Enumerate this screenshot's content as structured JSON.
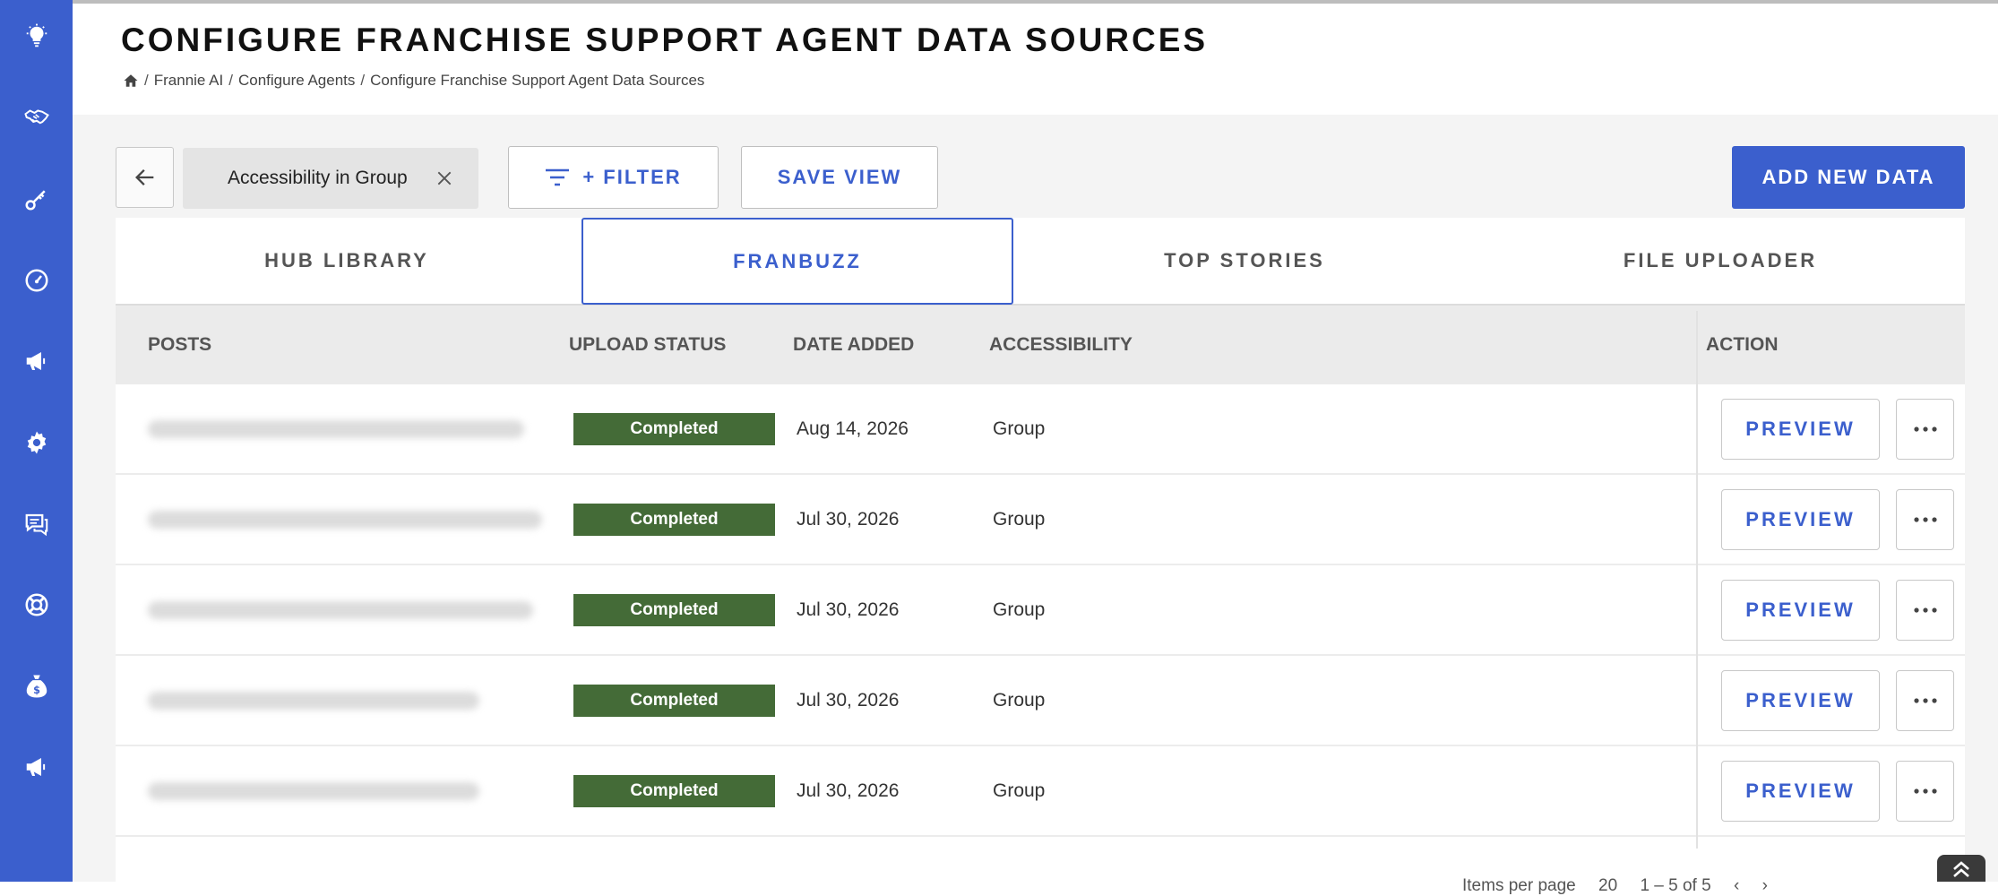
{
  "header": {
    "title": "CONFIGURE FRANCHISE SUPPORT AGENT DATA SOURCES",
    "breadcrumb": [
      "Frannie AI",
      "Configure Agents",
      "Configure Franchise Support Agent Data Sources"
    ]
  },
  "sidebar": {
    "icons": [
      "lightbulb-icon",
      "handshake-icon",
      "key-icon",
      "dashboard-gauge-icon",
      "megaphone-icon",
      "gear-icon",
      "chat-icon",
      "lifebuoy-icon",
      "money-bag-icon",
      "megaphone-icon"
    ]
  },
  "toolbar": {
    "filter_chip": "Accessibility in Group",
    "filter_label": "+ FILTER",
    "save_view_label": "SAVE VIEW",
    "add_new_label": "ADD NEW DATA"
  },
  "tabs": [
    {
      "label": "HUB LIBRARY",
      "active": false
    },
    {
      "label": "FRANBUZZ",
      "active": true
    },
    {
      "label": "TOP STORIES",
      "active": false
    },
    {
      "label": "FILE UPLOADER",
      "active": false
    }
  ],
  "table": {
    "columns": [
      "POSTS",
      "UPLOAD STATUS",
      "DATE ADDED",
      "ACCESSIBILITY",
      "ACTION"
    ],
    "rows": [
      {
        "status": "Completed",
        "date": "Aug 14, 2026",
        "accessibility": "Group",
        "preview": "PREVIEW"
      },
      {
        "status": "Completed",
        "date": "Jul 30, 2026",
        "accessibility": "Group",
        "preview": "PREVIEW"
      },
      {
        "status": "Completed",
        "date": "Jul 30, 2026",
        "accessibility": "Group",
        "preview": "PREVIEW"
      },
      {
        "status": "Completed",
        "date": "Jul 30, 2026",
        "accessibility": "Group",
        "preview": "PREVIEW"
      },
      {
        "status": "Completed",
        "date": "Jul 30, 2026",
        "accessibility": "Group",
        "preview": "PREVIEW"
      }
    ]
  },
  "pagination": {
    "items_per_page_label": "Items per page",
    "items_per_page": "20",
    "range": "1 – 5 of 5"
  },
  "colors": {
    "sidebar": "#3b5fcd",
    "accent": "#3b5fcd",
    "status_completed": "#446b37"
  }
}
